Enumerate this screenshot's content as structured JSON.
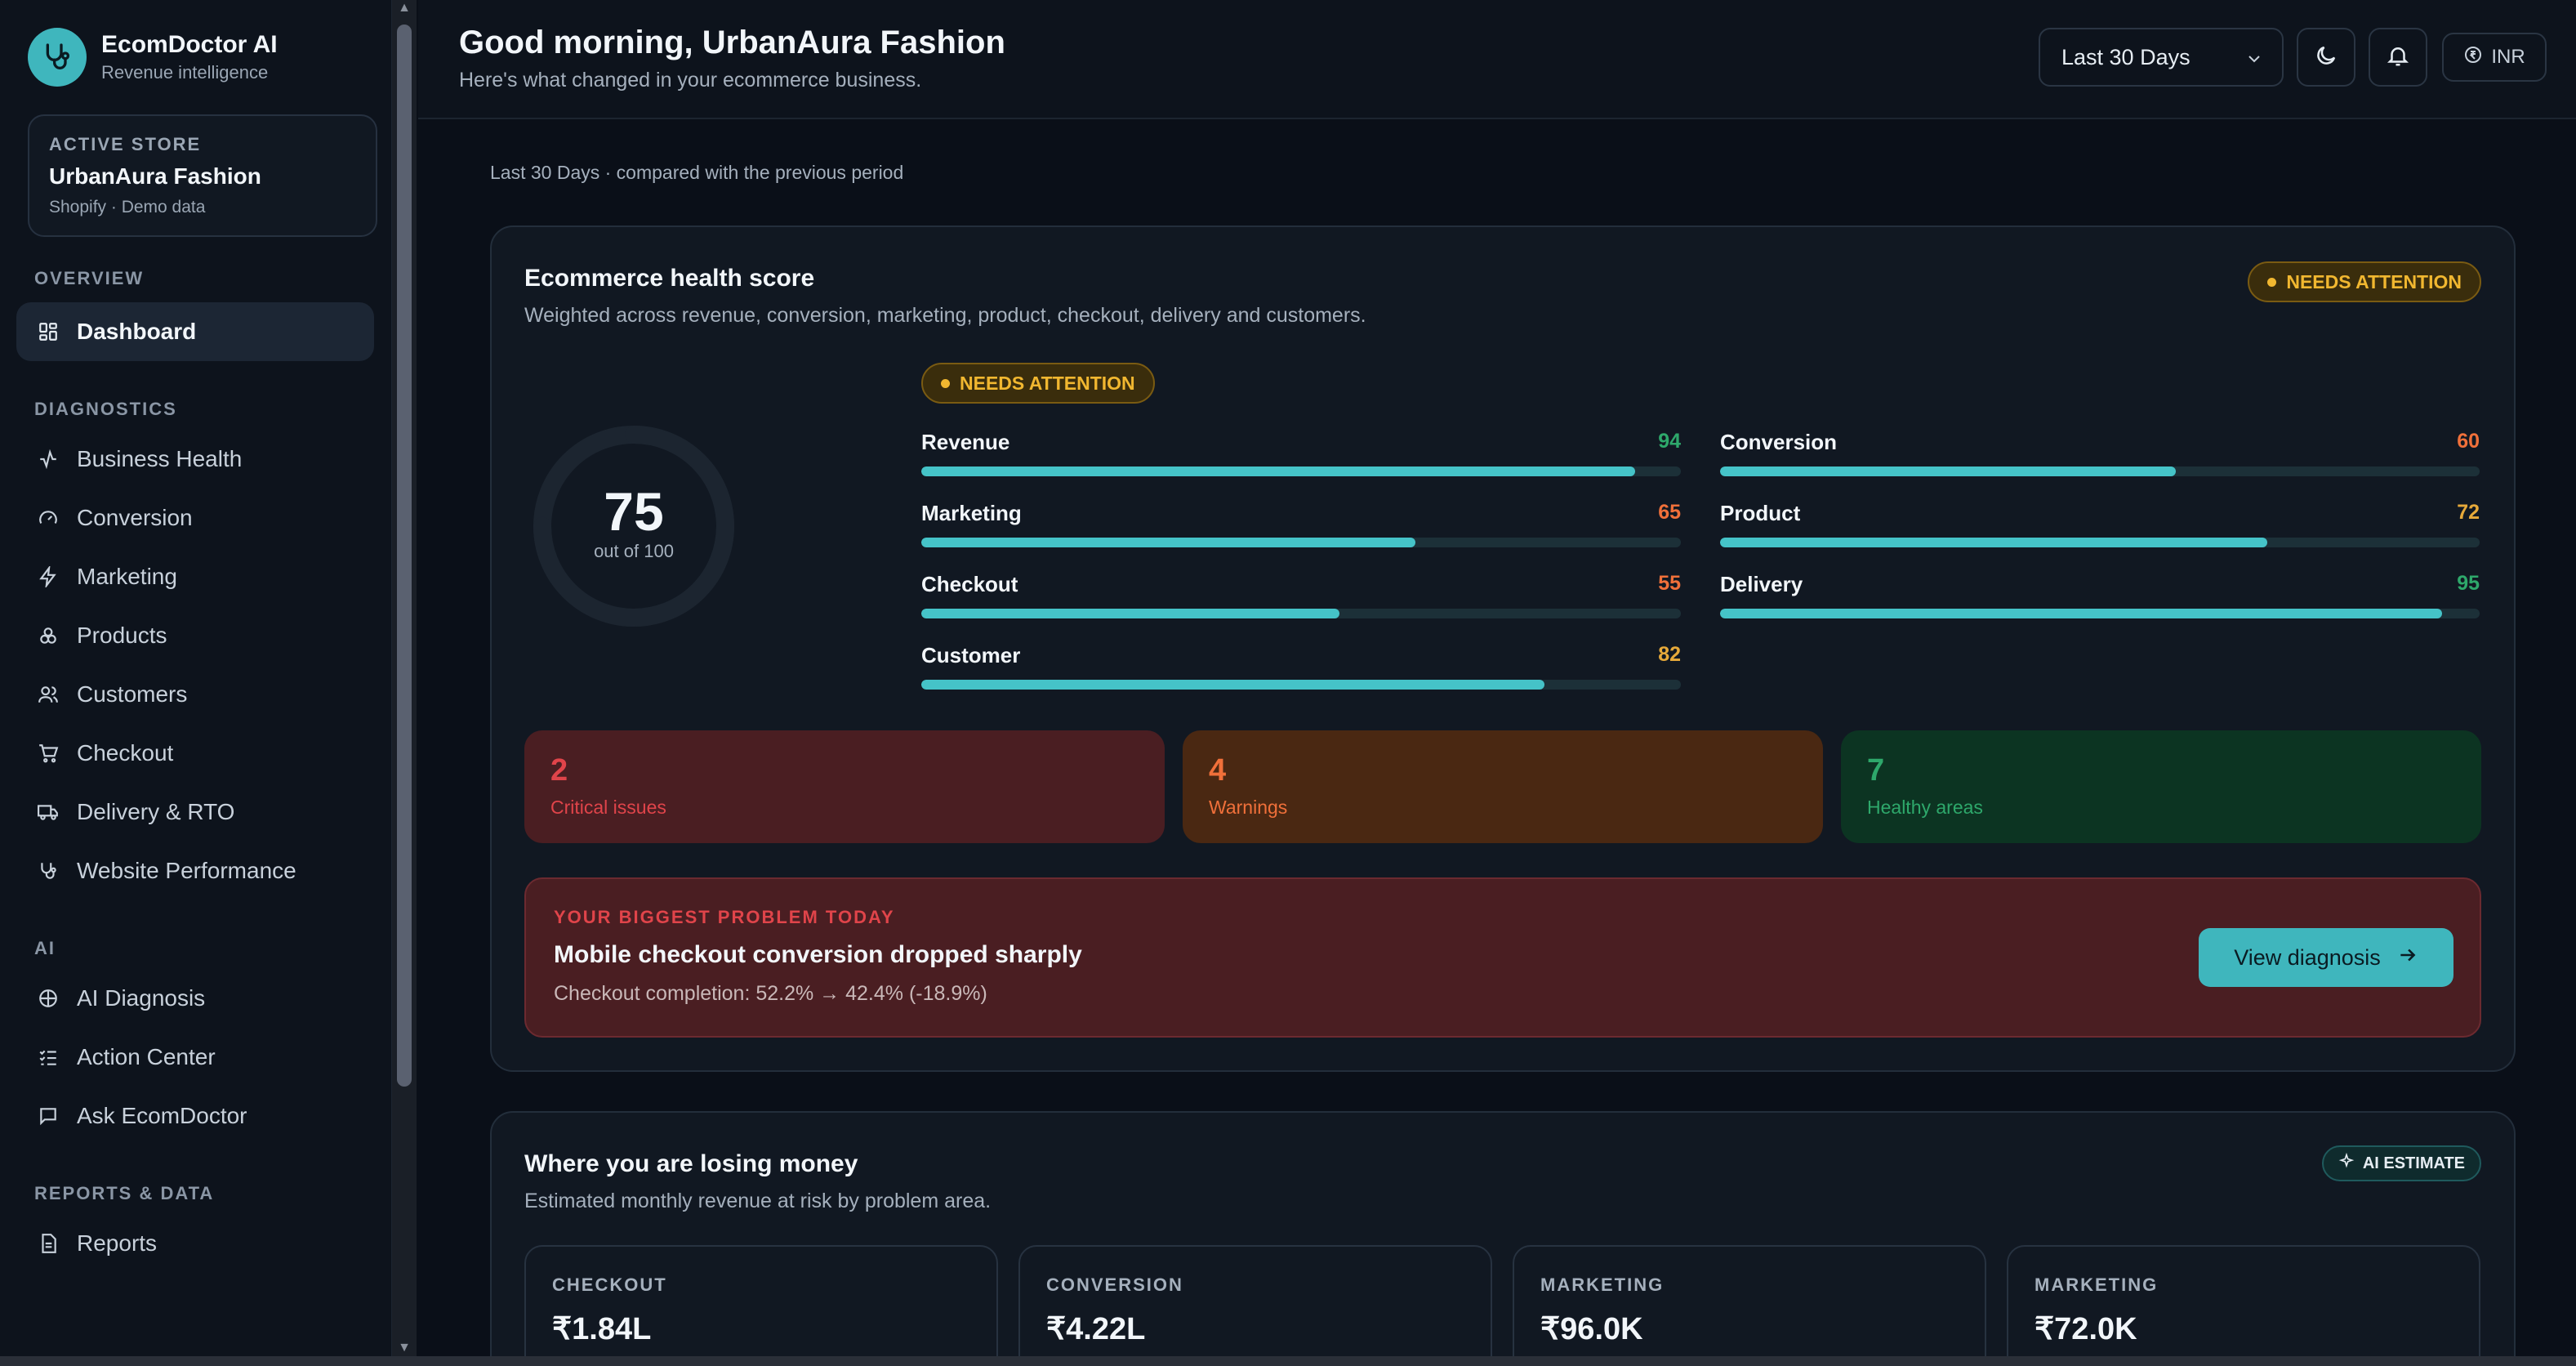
{
  "brand": {
    "name": "EcomDoctor AI",
    "tagline": "Revenue intelligence",
    "accent": "#3fb6bd"
  },
  "store": {
    "label": "ACTIVE STORE",
    "name": "UrbanAura Fashion",
    "meta": "Shopify · Demo data"
  },
  "nav": {
    "overview_label": "OVERVIEW",
    "dashboard": "Dashboard",
    "diagnostics_label": "DIAGNOSTICS",
    "diagnostics": [
      {
        "label": "Business Health",
        "icon": "activity-icon"
      },
      {
        "label": "Conversion",
        "icon": "gauge-icon"
      },
      {
        "label": "Marketing",
        "icon": "bolt-icon"
      },
      {
        "label": "Products",
        "icon": "boxes-icon"
      },
      {
        "label": "Customers",
        "icon": "users-icon"
      },
      {
        "label": "Checkout",
        "icon": "cart-icon"
      },
      {
        "label": "Delivery & RTO",
        "icon": "truck-icon"
      },
      {
        "label": "Website Performance",
        "icon": "stethoscope-icon"
      }
    ],
    "ai_label": "AI",
    "ai": [
      {
        "label": "AI Diagnosis",
        "icon": "brain-icon"
      },
      {
        "label": "Action Center",
        "icon": "checklist-icon"
      },
      {
        "label": "Ask EcomDoctor",
        "icon": "chat-icon"
      }
    ],
    "reports_label": "REPORTS & DATA",
    "reports": [
      {
        "label": "Reports",
        "icon": "file-icon"
      }
    ]
  },
  "header": {
    "greeting": "Good morning, UrbanAura Fashion",
    "subtitle": "Here's what changed in your ecommerce business.",
    "range": "Last 30 Days",
    "currency": "INR"
  },
  "period_note": "Last 30 Days · compared with the previous period",
  "health": {
    "title": "Ecommerce health score",
    "subtitle": "Weighted across revenue, conversion, marketing, product, checkout, delivery and customers.",
    "status": "NEEDS ATTENTION",
    "score": "75",
    "score_sub": "out of 100",
    "score_fraction": 0.75,
    "metrics": [
      {
        "name": "Revenue",
        "value": "94",
        "fraction": 0.94,
        "color": "#2ea86b"
      },
      {
        "name": "Conversion",
        "value": "60",
        "fraction": 0.6,
        "color": "#f0703a"
      },
      {
        "name": "Marketing",
        "value": "65",
        "fraction": 0.65,
        "color": "#f0703a"
      },
      {
        "name": "Product",
        "value": "72",
        "fraction": 0.72,
        "color": "#e6a93a"
      },
      {
        "name": "Checkout",
        "value": "55",
        "fraction": 0.55,
        "color": "#f0703a"
      },
      {
        "name": "Delivery",
        "value": "95",
        "fraction": 0.95,
        "color": "#2ea86b"
      },
      {
        "name": "Customer",
        "value": "82",
        "fraction": 0.82,
        "color": "#e6a93a"
      }
    ],
    "stats": [
      {
        "num": "2",
        "label": "Critical issues",
        "bg": "#4a1e22",
        "color": "#e0444a"
      },
      {
        "num": "4",
        "label": "Warnings",
        "bg": "#4a2812",
        "color": "#f0703a"
      },
      {
        "num": "7",
        "label": "Healthy areas",
        "bg": "#0c3422",
        "color": "#2ea86b"
      }
    ],
    "problem": {
      "eyebrow": "YOUR BIGGEST PROBLEM TODAY",
      "title": "Mobile checkout conversion dropped sharply",
      "detail": "Checkout completion: 52.2% → 42.4% (-18.9%)",
      "button": "View diagnosis"
    }
  },
  "losing": {
    "title": "Where you are losing money",
    "subtitle": "Estimated monthly revenue at risk by problem area.",
    "badge": "AI ESTIMATE",
    "tiles": [
      {
        "label": "CHECKOUT",
        "value": "₹1.84L"
      },
      {
        "label": "CONVERSION",
        "value": "₹4.22L"
      },
      {
        "label": "MARKETING",
        "value": "₹96.0K"
      },
      {
        "label": "MARKETING",
        "value": "₹72.0K"
      }
    ]
  }
}
